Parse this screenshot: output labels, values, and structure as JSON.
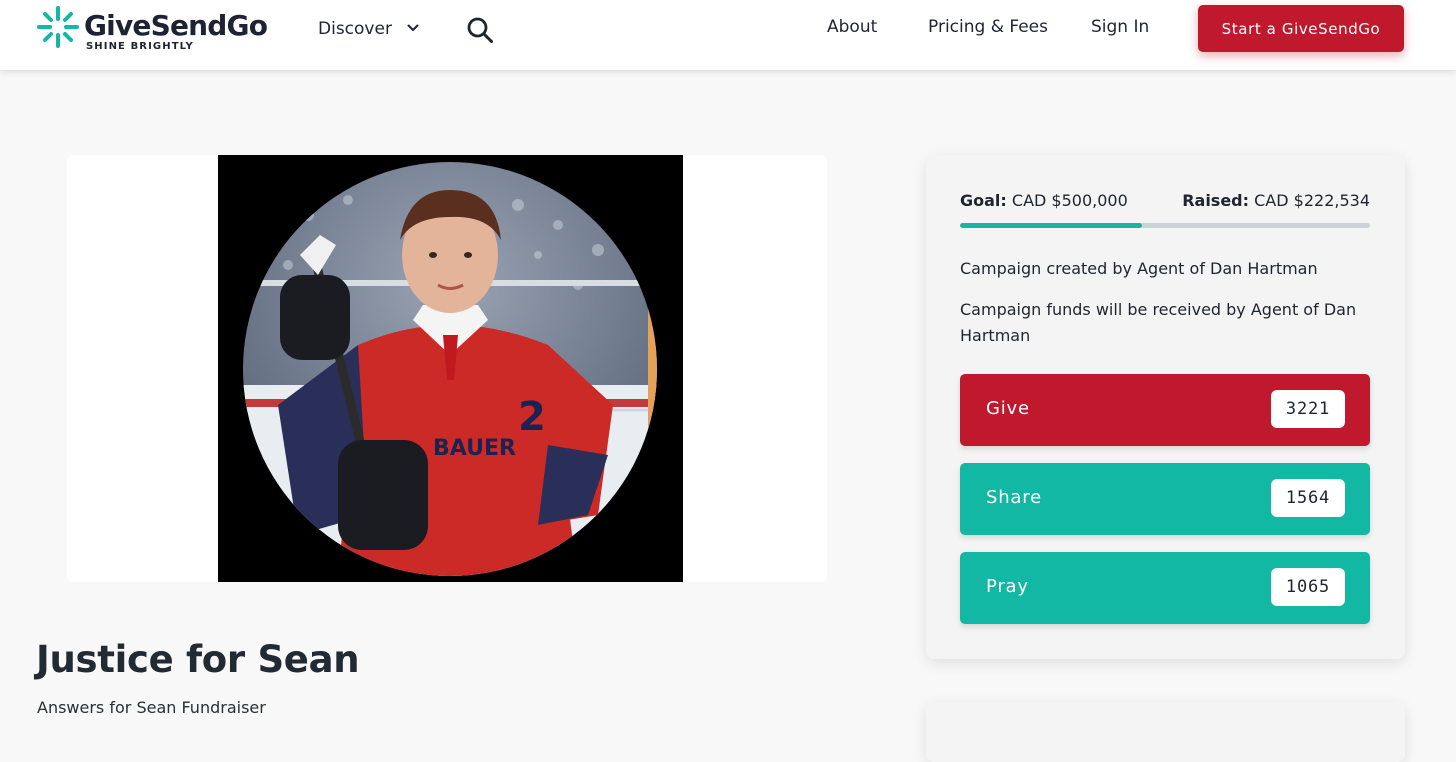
{
  "brand": {
    "name": "GiveSendGo",
    "tagline": "SHINE BRIGHTLY",
    "accent": "#12b8a3",
    "red": "#c0182c"
  },
  "nav": {
    "discover": "Discover",
    "discover_icon": "chevron-down-icon",
    "search_icon": "search-icon",
    "about": "About",
    "pricing": "Pricing & Fees",
    "sign_in": "Sign In",
    "start_button": "Start a GiveSendGo"
  },
  "campaign": {
    "photo_alt": "Boy in red hockey jersey holding a hockey stick",
    "title": "Justice for Sean",
    "subtitle": "Answers for Sean Fundraiser"
  },
  "sidebar": {
    "goal_label": "Goal:",
    "goal_value": "CAD $500,000",
    "raised_label": "Raised:",
    "raised_value": "CAD $222,534",
    "progress_fraction": 0.445,
    "created_prefix": "Campaign created by ",
    "created_by": "Agent of Dan Hartman",
    "funds_prefix": "Campaign funds will be received by ",
    "funds_by": "Agent of Dan Hartman",
    "actions": [
      {
        "label": "Give",
        "count": "3221",
        "color": "#c0182c"
      },
      {
        "label": "Share",
        "count": "1564",
        "color": "#12b8a3"
      },
      {
        "label": "Pray",
        "count": "1065",
        "color": "#12b8a3"
      }
    ]
  }
}
